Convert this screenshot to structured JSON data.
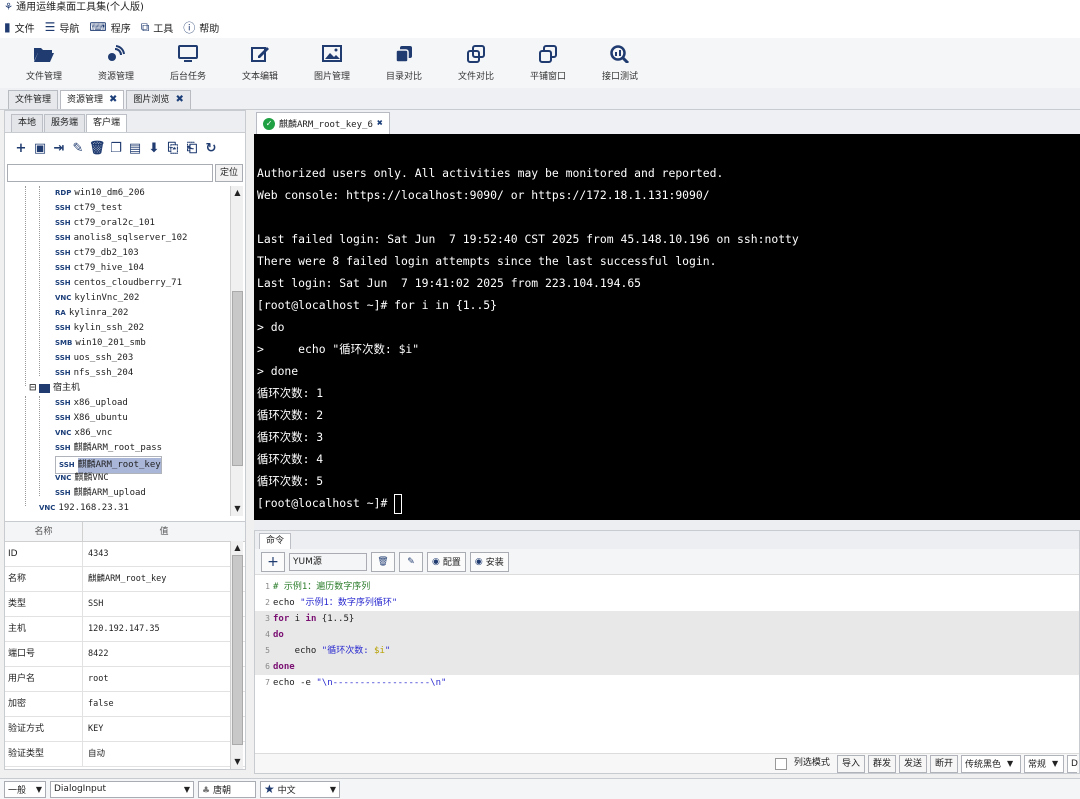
{
  "window": {
    "title": "通用运维桌面工具集(个人版)"
  },
  "menu": [
    "文件",
    "导航",
    "程序",
    "工具",
    "帮助"
  ],
  "toolbar": [
    "文件管理",
    "资源管理",
    "后台任务",
    "文本编辑",
    "图片管理",
    "目录对比",
    "文件对比",
    "平铺窗口",
    "接口测试"
  ],
  "main_tabs": [
    {
      "label": "文件管理",
      "closable": false
    },
    {
      "label": "资源管理",
      "closable": true
    },
    {
      "label": "图片浏览",
      "closable": true
    }
  ],
  "left_tabs": [
    "本地",
    "服务端",
    "客户端"
  ],
  "locate_button": "定位",
  "tree": [
    {
      "badge": "RDP",
      "label": "win10_dm6_206",
      "indent": 1
    },
    {
      "badge": "SSH",
      "label": "ct79_test",
      "indent": 1
    },
    {
      "badge": "SSH",
      "label": "ct79_oral2c_101",
      "indent": 1
    },
    {
      "badge": "SSH",
      "label": "anolis8_sqlserver_102",
      "indent": 1
    },
    {
      "badge": "SSH",
      "label": "ct79_db2_103",
      "indent": 1
    },
    {
      "badge": "SSH",
      "label": "ct79_hive_104",
      "indent": 1
    },
    {
      "badge": "SSH",
      "label": "centos_cloudberry_71",
      "indent": 1
    },
    {
      "badge": "VNC",
      "label": "kylinVnc_202",
      "indent": 1
    },
    {
      "badge": "RA",
      "label": "kylinra_202",
      "indent": 1
    },
    {
      "badge": "SSH",
      "label": "kylin_ssh_202",
      "indent": 1
    },
    {
      "badge": "SMB",
      "label": "win10_201_smb",
      "indent": 1
    },
    {
      "badge": "SSH",
      "label": "uos_ssh_203",
      "indent": 1
    },
    {
      "badge": "SSH",
      "label": "nfs_ssh_204",
      "indent": 1
    },
    {
      "badge": "folder",
      "label": "宿主机",
      "indent": 0
    },
    {
      "badge": "SSH",
      "label": "x86_upload",
      "indent": 1
    },
    {
      "badge": "SSH",
      "label": "X86_ubuntu",
      "indent": 1
    },
    {
      "badge": "VNC",
      "label": "x86_vnc",
      "indent": 1
    },
    {
      "badge": "SSH",
      "label": "麒麟ARM_root_pass",
      "indent": 1
    },
    {
      "badge": "SSH",
      "label": "麒麟ARM_root_key",
      "indent": 1,
      "selected": true
    },
    {
      "badge": "VNC",
      "label": "麒麟VNC",
      "indent": 1
    },
    {
      "badge": "SSH",
      "label": "麒麟ARM_upload",
      "indent": 1
    },
    {
      "badge": "VNC",
      "label": "192.168.23.31",
      "indent": 0
    }
  ],
  "props": {
    "headers": [
      "名称",
      "值"
    ],
    "rows": [
      [
        "ID",
        "4343"
      ],
      [
        "名称",
        "麒麟ARM_root_key"
      ],
      [
        "类型",
        "SSH"
      ],
      [
        "主机",
        "120.192.147.35"
      ],
      [
        "端口号",
        "8422"
      ],
      [
        "用户名",
        "root"
      ],
      [
        "加密",
        "false"
      ],
      [
        "验证方式",
        "KEY"
      ],
      [
        "验证类型",
        "自动"
      ]
    ]
  },
  "terminal_tab": "麒麟ARM_root_key_6",
  "terminal_lines": [
    "Authorized users only. All activities may be monitored and reported.",
    "Web console: https://localhost:9090/ or https://172.18.1.131:9090/",
    "",
    "Last failed login: Sat Jun  7 19:52:40 CST 2025 from 45.148.10.196 on ssh:notty",
    "There were 8 failed login attempts since the last successful login.",
    "Last login: Sat Jun  7 19:41:02 2025 from 223.104.194.65",
    "[root@localhost ~]# for i in {1..5}",
    "> do",
    ">     echo \"循环次数: $i\"",
    "> done",
    "循环次数: 1",
    "循环次数: 2",
    "循环次数: 3",
    "循环次数: 4",
    "循环次数: 5",
    "[root@localhost ~]# "
  ],
  "cmd": {
    "tab": "命令",
    "input_value": "YUM源",
    "config_label": "配置",
    "install_label": "安装"
  },
  "bottom": {
    "list_mode": "列选模式",
    "import": "导入",
    "broadcast": "群发",
    "send": "发送",
    "disconnect": "断开",
    "theme": "传统黑色",
    "mode": "常规",
    "last": "D"
  },
  "status": {
    "level": "一般",
    "input": "DialogInput",
    "font": "唐朝",
    "lang": "中文"
  }
}
